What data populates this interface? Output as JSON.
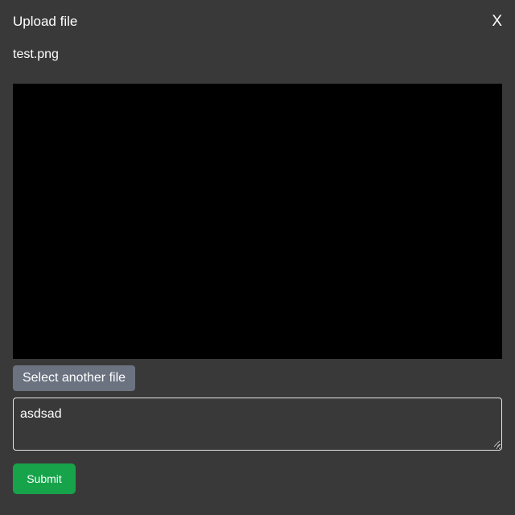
{
  "dialog": {
    "title": "Upload file",
    "close_label": "X"
  },
  "file": {
    "name": "test.png",
    "preview_color": "#000000"
  },
  "actions": {
    "select_another_label": "Select another file",
    "submit_label": "Submit"
  },
  "comment": {
    "value": "asdsad"
  },
  "colors": {
    "background": "#3a3939",
    "select_button": "#6b7280",
    "submit_button": "#16a34a",
    "border": "#e5e5e5",
    "text": "#ffffff"
  }
}
